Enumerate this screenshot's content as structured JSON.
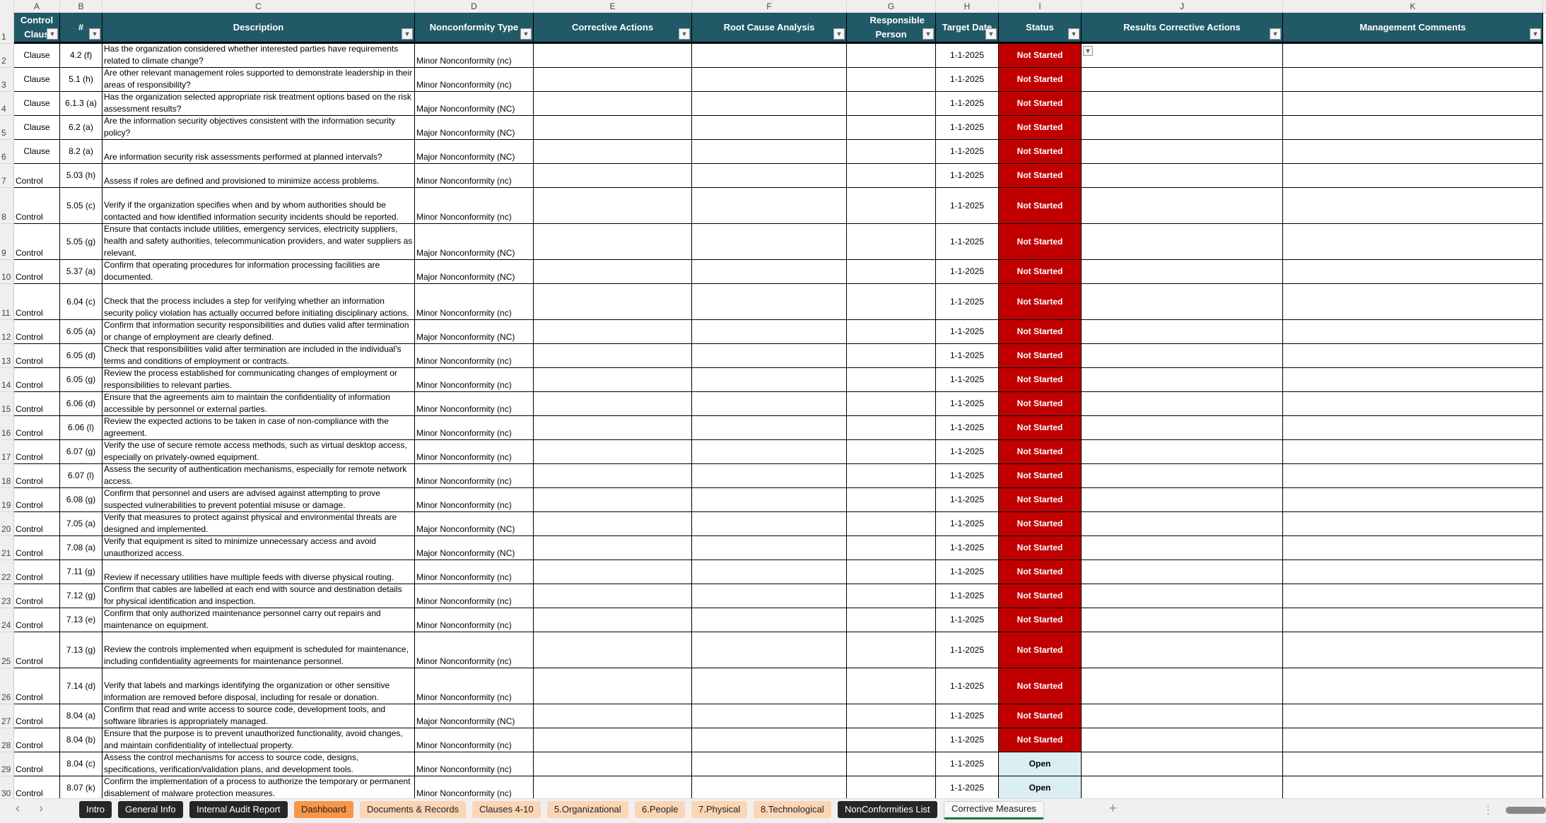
{
  "column_letters": [
    "A",
    "B",
    "C",
    "D",
    "E",
    "F",
    "G",
    "H",
    "I",
    "J",
    "K"
  ],
  "headers": [
    "Control Claus",
    "#",
    "Description",
    "Nonconformity Type",
    "Corrective Actions",
    "Root Cause Analysis",
    "Responsible Person",
    "Target Date",
    "Status",
    "Results Corrective Actions",
    "Management Comments"
  ],
  "rows": [
    {
      "n": "2",
      "type": "Clause",
      "id": "4.2 (f)",
      "desc": "Has the organization considered whether interested parties have requirements related to climate change?",
      "nc": "Minor Nonconformity (nc)",
      "date": "1-1-2025",
      "status": "Not Started"
    },
    {
      "n": "3",
      "type": "Clause",
      "id": "5.1 (h)",
      "desc": "Are other relevant management roles supported to demonstrate leadership in their areas of responsibility?",
      "nc": "Minor Nonconformity (nc)",
      "date": "1-1-2025",
      "status": "Not Started"
    },
    {
      "n": "4",
      "type": "Clause",
      "id": "6.1.3 (a)",
      "desc": "Has the organization selected appropriate risk treatment options based on the risk assessment results?",
      "nc": "Major Nonconformity (NC)",
      "date": "1-1-2025",
      "status": "Not Started"
    },
    {
      "n": "5",
      "type": "Clause",
      "id": "6.2 (a)",
      "desc": "Are the information security objectives consistent with the information security policy?",
      "nc": "Major Nonconformity (NC)",
      "date": "1-1-2025",
      "status": "Not Started"
    },
    {
      "n": "6",
      "type": "Clause",
      "id": "8.2 (a)",
      "desc": "Are information security risk assessments performed at planned intervals?",
      "nc": "Major Nonconformity (NC)",
      "date": "1-1-2025",
      "status": "Not Started"
    },
    {
      "n": "7",
      "type": "Control",
      "id": "5.03 (h)",
      "desc": "Assess if roles are defined and provisioned to minimize access problems.",
      "nc": "Minor Nonconformity (nc)",
      "date": "1-1-2025",
      "status": "Not Started"
    },
    {
      "n": "8",
      "type": "Control",
      "id": "5.05 (c)",
      "desc": "Verify if the organization specifies when and by whom authorities should be contacted and how identified information security incidents should be reported.",
      "nc": "Minor Nonconformity (nc)",
      "date": "1-1-2025",
      "status": "Not Started"
    },
    {
      "n": "9",
      "type": "Control",
      "id": "5.05 (g)",
      "desc": "Ensure that contacts include utilities, emergency services, electricity suppliers, health and safety authorities, telecommunication providers, and water suppliers as relevant.",
      "nc": "Major Nonconformity (NC)",
      "date": "1-1-2025",
      "status": "Not Started"
    },
    {
      "n": "10",
      "type": "Control",
      "id": "5.37 (a)",
      "desc": "Confirm that operating procedures for information processing facilities are documented.",
      "nc": "Major Nonconformity (NC)",
      "date": "1-1-2025",
      "status": "Not Started"
    },
    {
      "n": "11",
      "type": "Control",
      "id": "6.04 (c)",
      "desc": "Check that the process includes a step for verifying whether an information security policy violation has actually occurred before initiating disciplinary actions.",
      "nc": "Minor Nonconformity (nc)",
      "date": "1-1-2025",
      "status": "Not Started"
    },
    {
      "n": "12",
      "type": "Control",
      "id": "6.05 (a)",
      "desc": "Confirm that information security responsibilities and duties valid after termination or change of employment are clearly defined.",
      "nc": "Major Nonconformity (NC)",
      "date": "1-1-2025",
      "status": "Not Started"
    },
    {
      "n": "13",
      "type": "Control",
      "id": "6.05 (d)",
      "desc": "Check that responsibilities valid after termination are included in the individual's terms and conditions of employment or contracts.",
      "nc": "Minor Nonconformity (nc)",
      "date": "1-1-2025",
      "status": "Not Started"
    },
    {
      "n": "14",
      "type": "Control",
      "id": "6.05 (g)",
      "desc": "Review the process established for communicating changes of employment or responsibilities to relevant parties.",
      "nc": "Minor Nonconformity (nc)",
      "date": "1-1-2025",
      "status": "Not Started"
    },
    {
      "n": "15",
      "type": "Control",
      "id": "6.06 (d)",
      "desc": "Ensure that the agreements aim to maintain the confidentiality of information accessible by personnel or external parties.",
      "nc": "Minor Nonconformity (nc)",
      "date": "1-1-2025",
      "status": "Not Started"
    },
    {
      "n": "16",
      "type": "Control",
      "id": "6.06 (l)",
      "desc": "Review the expected actions to be taken in case of non-compliance with the agreement.",
      "nc": "Minor Nonconformity (nc)",
      "date": "1-1-2025",
      "status": "Not Started"
    },
    {
      "n": "17",
      "type": "Control",
      "id": "6.07 (g)",
      "desc": "Verify the use of secure remote access methods, such as virtual desktop access, especially on privately-owned equipment.",
      "nc": "Minor Nonconformity (nc)",
      "date": "1-1-2025",
      "status": "Not Started"
    },
    {
      "n": "18",
      "type": "Control",
      "id": "6.07 (l)",
      "desc": "Assess the security of authentication mechanisms, especially for remote network access.",
      "nc": "Minor Nonconformity (nc)",
      "date": "1-1-2025",
      "status": "Not Started"
    },
    {
      "n": "19",
      "type": "Control",
      "id": "6.08 (g)",
      "desc": "Confirm that personnel and users are advised against attempting to prove suspected vulnerabilities to prevent potential misuse or damage.",
      "nc": "Minor Nonconformity (nc)",
      "date": "1-1-2025",
      "status": "Not Started"
    },
    {
      "n": "20",
      "type": "Control",
      "id": "7.05 (a)",
      "desc": "Verify that measures to protect against physical and environmental threats are designed and implemented.",
      "nc": "Major Nonconformity (NC)",
      "date": "1-1-2025",
      "status": "Not Started"
    },
    {
      "n": "21",
      "type": "Control",
      "id": "7.08 (a)",
      "desc": "Verify that equipment is sited to minimize unnecessary access and avoid unauthorized access.",
      "nc": "Major Nonconformity (NC)",
      "date": "1-1-2025",
      "status": "Not Started"
    },
    {
      "n": "22",
      "type": "Control",
      "id": "7.11 (g)",
      "desc": "Review if necessary utilities have multiple feeds with diverse physical routing.",
      "nc": "Minor Nonconformity (nc)",
      "date": "1-1-2025",
      "status": "Not Started"
    },
    {
      "n": "23",
      "type": "Control",
      "id": "7.12 (g)",
      "desc": "Confirm that cables are labelled at each end with source and destination details for physical identification and inspection.",
      "nc": "Minor Nonconformity (nc)",
      "date": "1-1-2025",
      "status": "Not Started"
    },
    {
      "n": "24",
      "type": "Control",
      "id": "7.13 (e)",
      "desc": "Confirm that only authorized maintenance personnel carry out repairs and maintenance on equipment.",
      "nc": "Minor Nonconformity (nc)",
      "date": "1-1-2025",
      "status": "Not Started"
    },
    {
      "n": "25",
      "type": "Control",
      "id": "7.13 (g)",
      "desc": "Review the controls implemented when equipment is scheduled for maintenance, including confidentiality agreements for maintenance personnel.",
      "nc": "Minor Nonconformity (nc)",
      "date": "1-1-2025",
      "status": "Not Started"
    },
    {
      "n": "26",
      "type": "Control",
      "id": "7.14 (d)",
      "desc": "Verify that labels and markings identifying the organization or other sensitive information are removed before disposal, including for resale or donation.",
      "nc": "Minor Nonconformity (nc)",
      "date": "1-1-2025",
      "status": "Not Started"
    },
    {
      "n": "27",
      "type": "Control",
      "id": "8.04 (a)",
      "desc": "Confirm that read and write access to source code, development tools, and software libraries is appropriately managed.",
      "nc": "Major Nonconformity (NC)",
      "date": "1-1-2025",
      "status": "Not Started"
    },
    {
      "n": "28",
      "type": "Control",
      "id": "8.04 (b)",
      "desc": "Ensure that the purpose is to prevent unauthorized functionality, avoid changes, and maintain confidentiality of intellectual property.",
      "nc": "Minor Nonconformity (nc)",
      "date": "1-1-2025",
      "status": "Not Started"
    },
    {
      "n": "29",
      "type": "Control",
      "id": "8.04 (c)",
      "desc": "Assess the control mechanisms for access to source code, designs, specifications, verification/validation plans, and development tools.",
      "nc": "Minor Nonconformity (nc)",
      "date": "1-1-2025",
      "status": "Open"
    },
    {
      "n": "30",
      "type": "Control",
      "id": "8.07 (k)",
      "desc": "Confirm the implementation of a process to authorize the temporary or permanent disablement of malware protection measures.",
      "nc": "Minor Nonconformity (nc)",
      "date": "1-1-2025",
      "status": "Open"
    }
  ],
  "header_row_number": "1",
  "tabs": [
    {
      "label": "Intro",
      "style": "dark"
    },
    {
      "label": "General Info",
      "style": "dark"
    },
    {
      "label": "Internal Audit Report",
      "style": "dark"
    },
    {
      "label": "Dashboard",
      "style": "orange"
    },
    {
      "label": "Documents & Records",
      "style": "peach"
    },
    {
      "label": "Clauses 4-10",
      "style": "peach"
    },
    {
      "label": "5.Organizational",
      "style": "peach"
    },
    {
      "label": "6.People",
      "style": "peach"
    },
    {
      "label": "7.Physical",
      "style": "peach"
    },
    {
      "label": "8.Technological",
      "style": "peach"
    },
    {
      "label": "NonConformities List",
      "style": "dark"
    },
    {
      "label": "Corrective Measures",
      "style": "active"
    }
  ],
  "tab_controls": {
    "prev": "‹",
    "next": "›",
    "add": "+",
    "more": "⋮"
  },
  "colors": {
    "header": "#215967",
    "not_started": "#c00000",
    "open": "#daeef3",
    "dashboard_tab": "#f79646",
    "section_tab": "#fcd5b4"
  }
}
